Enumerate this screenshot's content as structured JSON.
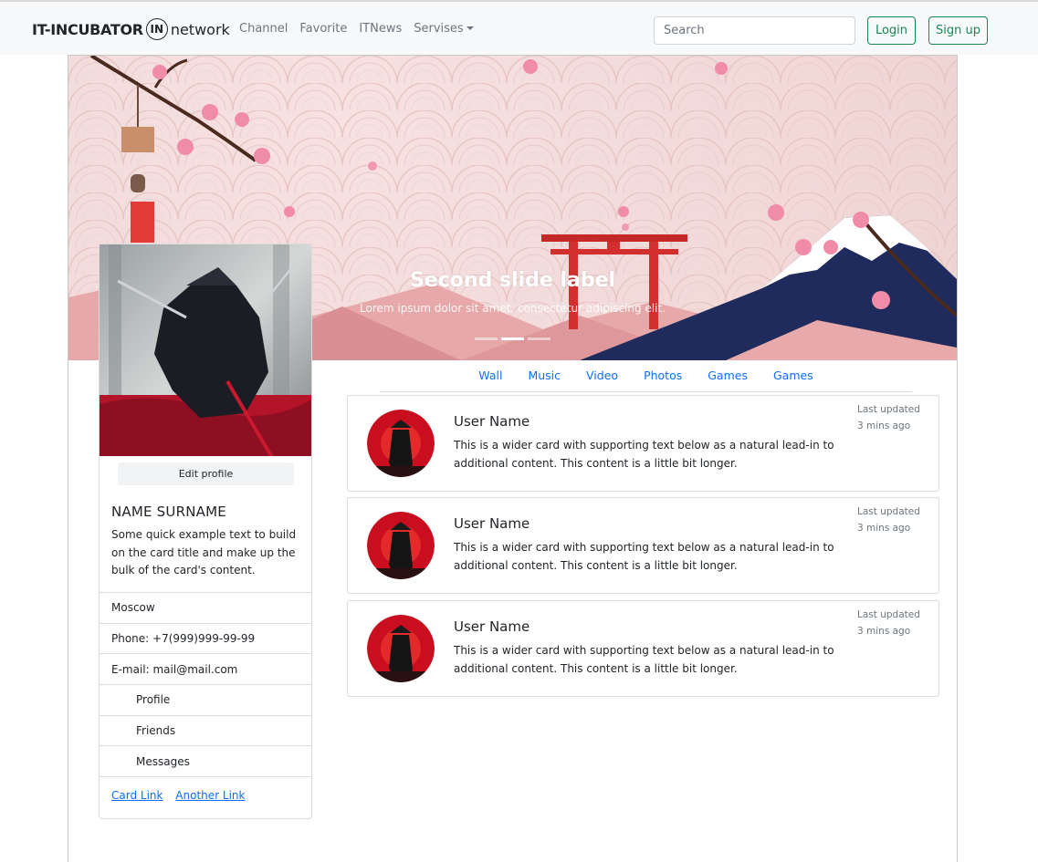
{
  "navbar": {
    "brand_left": "IT-INCUBATOR",
    "brand_logo": "IN",
    "brand_right": "network",
    "links": [
      "Channel",
      "Favorite",
      "ITNews",
      "Servises"
    ],
    "search_placeholder": "Search",
    "login_label": "Login",
    "signup_label": "Sign up"
  },
  "banner": {
    "caption_title": "Second slide label",
    "caption_text": "Lorem ipsum dolor sit amet, consectetur adipiscing elit.",
    "active_slide": 2,
    "slide_count": 3
  },
  "profile": {
    "edit_label": "Edit profile",
    "name": "NAME SURNAME",
    "description": "Some quick example text to build on the card title and make up the bulk of the card's content.",
    "city": "Moscow",
    "phone": "Phone: +7(999)999-99-99",
    "email": "E-mail: mail@mail.com",
    "menu": [
      "Profile",
      "Friends",
      "Messages"
    ],
    "link1": "Card Link",
    "link2": "Another Link"
  },
  "tabs": [
    "Wall",
    "Music",
    "Video",
    "Photos",
    "Games",
    "Games"
  ],
  "posts": [
    {
      "user": "User Name",
      "text": "This is a wider card with supporting text below as a natural lead-in to additional content. This content is a little bit longer.",
      "meta_label": "Last updated",
      "meta_time": "3 mins ago"
    },
    {
      "user": "User Name",
      "text": "This is a wider card with supporting text below as a natural lead-in to additional content. This content is a little bit longer.",
      "meta_label": "Last updated",
      "meta_time": "3 mins ago"
    },
    {
      "user": "User Name",
      "text": "This is a wider card with supporting text below as a natural lead-in to additional content. This content is a little bit longer.",
      "meta_label": "Last updated",
      "meta_time": "3 mins ago"
    }
  ],
  "colors": {
    "accent_link": "#0d6efd",
    "success": "#198754",
    "navbar_bg": "#f8f9fa",
    "banner_pink": "#f3dcdc",
    "torii_red": "#d32f2f",
    "mountain_navy": "#1e2a5a"
  }
}
